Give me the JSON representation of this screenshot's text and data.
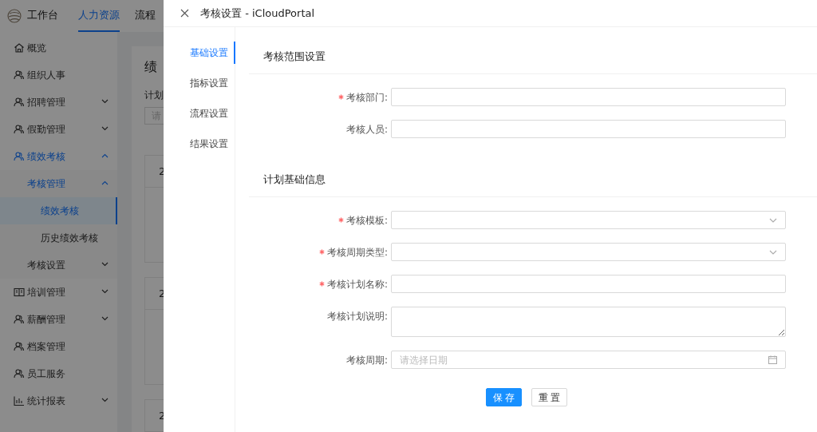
{
  "top_nav": [
    {
      "label": "工作台",
      "selected": false
    },
    {
      "label": "人力资源",
      "selected": true
    },
    {
      "label": "流程",
      "selected": false
    }
  ],
  "sidebar": {
    "items": [
      {
        "label": "概览",
        "kind": "home",
        "selected": false
      },
      {
        "label": "组织人事",
        "kind": "person",
        "selected": false
      },
      {
        "label": "招聘管理",
        "kind": "person",
        "selected": false,
        "expanded": false
      },
      {
        "label": "假勤管理",
        "kind": "person",
        "selected": false,
        "expanded": false
      },
      {
        "label": "绩效考核",
        "kind": "person",
        "selected": false,
        "expanded": true,
        "children": [
          {
            "label": "考核管理",
            "selected": false,
            "expanded": true,
            "children": [
              {
                "label": "绩效考核",
                "selected": true
              },
              {
                "label": "历史绩效考核",
                "selected": false
              }
            ]
          },
          {
            "label": "考核设置",
            "selected": false,
            "expanded": false
          }
        ]
      },
      {
        "label": "培训管理",
        "kind": "book",
        "selected": false,
        "expanded": false
      },
      {
        "label": "薪酬管理",
        "kind": "person",
        "selected": false,
        "expanded": false
      },
      {
        "label": "档案管理",
        "kind": "person",
        "selected": false
      },
      {
        "label": "员工服务",
        "kind": "person",
        "selected": false
      },
      {
        "label": "统计报表",
        "kind": "chart",
        "selected": false,
        "expanded": false
      }
    ]
  },
  "background_page": {
    "title": "绩",
    "filter_label": "计划",
    "search_placeholder": "请",
    "cards": [
      {
        "header": "2"
      },
      {
        "header": "2"
      },
      {
        "header": "2"
      }
    ]
  },
  "drawer": {
    "title": "考核设置 - iCloudPortal",
    "tabs": [
      {
        "label": "基础设置",
        "selected": true
      },
      {
        "label": "指标设置",
        "selected": false
      },
      {
        "label": "流程设置",
        "selected": false
      },
      {
        "label": "结果设置",
        "selected": false
      }
    ],
    "sections": [
      {
        "title": "考核范围设置",
        "fields": [
          {
            "label": "考核部门:",
            "required": true,
            "kind": "input"
          },
          {
            "label": "考核人员:",
            "required": false,
            "kind": "input"
          }
        ]
      },
      {
        "title": "计划基础信息",
        "fields": [
          {
            "label": "考核模板:",
            "required": true,
            "kind": "select"
          },
          {
            "label": "考核周期类型:",
            "required": true,
            "kind": "select"
          },
          {
            "label": "考核计划名称:",
            "required": true,
            "kind": "input"
          },
          {
            "label": "考核计划说明:",
            "required": false,
            "kind": "textarea"
          },
          {
            "label": "考核周期:",
            "required": false,
            "kind": "date",
            "placeholder": "请选择日期"
          }
        ]
      }
    ],
    "buttons": [
      {
        "label": "保 存",
        "kind": "primary"
      },
      {
        "label": "重 置",
        "kind": "default"
      }
    ]
  }
}
